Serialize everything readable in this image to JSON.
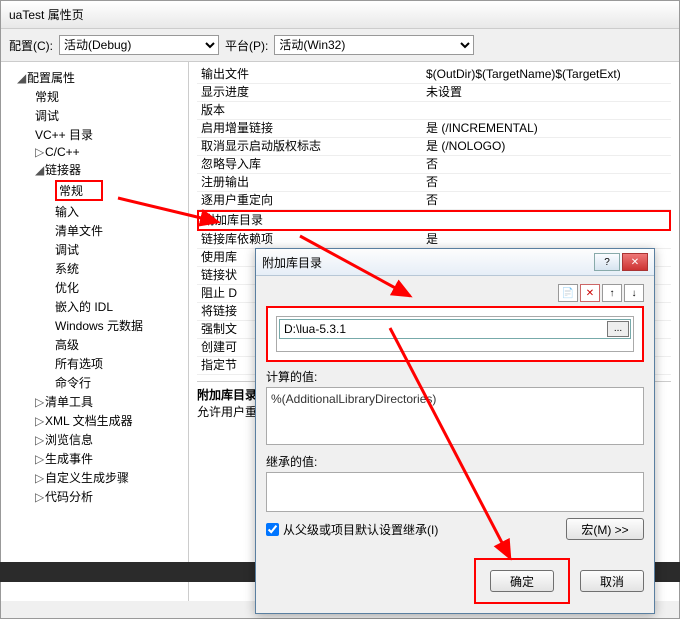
{
  "window": {
    "title": "uaTest 属性页"
  },
  "config": {
    "label": "配置(C):",
    "value": "活动(Debug)"
  },
  "platform": {
    "label": "平台(P):",
    "value": "活动(Win32)"
  },
  "tree": {
    "root": "配置属性",
    "items": [
      "常规",
      "调试",
      "VC++ 目录"
    ],
    "cxx": "C/C++",
    "linker": "链接器",
    "linker_items": [
      "常规",
      "输入",
      "清单文件",
      "调试",
      "系统",
      "优化",
      "嵌入的 IDL",
      "Windows 元数据",
      "高级",
      "所有选项",
      "命令行"
    ],
    "others": [
      "清单工具",
      "XML 文档生成器",
      "浏览信息",
      "生成事件",
      "自定义生成步骤",
      "代码分析"
    ]
  },
  "props": [
    {
      "name": "输出文件",
      "value": "$(OutDir)$(TargetName)$(TargetExt)"
    },
    {
      "name": "显示进度",
      "value": "未设置"
    },
    {
      "name": "版本",
      "value": ""
    },
    {
      "name": "启用增量链接",
      "value": "是 (/INCREMENTAL)"
    },
    {
      "name": "取消显示启动版权标志",
      "value": "是 (/NOLOGO)"
    },
    {
      "name": "忽略导入库",
      "value": "否"
    },
    {
      "name": "注册输出",
      "value": "否"
    },
    {
      "name": "逐用户重定向",
      "value": "否"
    },
    {
      "name": "附加库目录",
      "value": ""
    },
    {
      "name": "链接库依赖项",
      "value": "是"
    },
    {
      "name": "使用库",
      "value": ""
    },
    {
      "name": "链接状",
      "value": ""
    },
    {
      "name": "阻止 D",
      "value": ""
    },
    {
      "name": "将链接",
      "value": ""
    },
    {
      "name": "强制文",
      "value": ""
    },
    {
      "name": "创建可",
      "value": ""
    },
    {
      "name": "指定节",
      "value": ""
    }
  ],
  "bottom": {
    "title": "附加库目录",
    "desc": "允许用户重"
  },
  "dialog": {
    "title": "附加库目录",
    "help_icon": "?",
    "close_icon": "✕",
    "toolbar": {
      "new": "📄",
      "delete": "✕",
      "up": "↑",
      "down": "↓"
    },
    "path_value": "D:\\lua-5.3.1",
    "browse": "...",
    "calc_label": "计算的值:",
    "calc_value": "%(AdditionalLibraryDirectories)",
    "inherit_label": "继承的值:",
    "checkbox_label": "从父级或项目默认设置继承(I)",
    "macro_btn": "宏(M) >>",
    "ok": "确定",
    "cancel": "取消"
  }
}
